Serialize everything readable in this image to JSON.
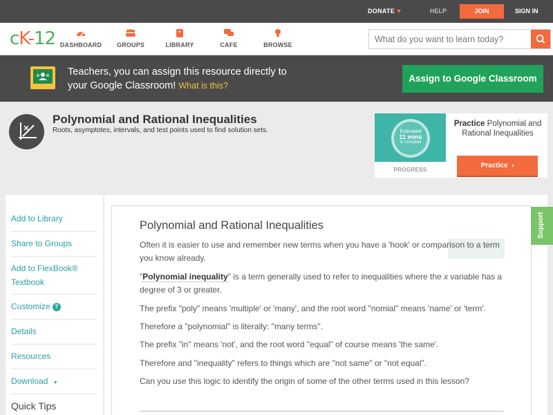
{
  "topbar": {
    "donate": "DONATE",
    "help": "HELP",
    "join": "JOIN",
    "signin": "SIGN IN"
  },
  "nav": {
    "logo_c": "c",
    "logo_k": "K",
    "logo_dash": "-",
    "logo_12": "12",
    "items": [
      {
        "label": "DASHBOARD",
        "icon": "dashboard-gauge-icon"
      },
      {
        "label": "GROUPS",
        "icon": "groups-people-icon"
      },
      {
        "label": "LIBRARY",
        "icon": "library-book-icon"
      },
      {
        "label": "CAFE",
        "icon": "cafe-chat-icon"
      },
      {
        "label": "BROWSE",
        "icon": "browse-lightbulb-icon"
      }
    ],
    "search_placeholder": "What do you want to learn today?"
  },
  "banner": {
    "text_line1": "Teachers, you can assign this resource directly to",
    "text_line2": "your Google Classroom!",
    "what_link": "What is this?",
    "button": "Assign to Google Classroom"
  },
  "lesson": {
    "title": "Polynomial and Rational Inequalities",
    "subtitle": "Roots, asymptotes, intervals, and test points used to find solution sets."
  },
  "practice_card": {
    "estimated": "Estimated",
    "mins": "11 mins",
    "to_complete": "to complete",
    "progress": "PROGRESS",
    "title_bold": "Practice",
    "title_rest": "Polynomial and Rational Inequalities",
    "button": "Practice"
  },
  "sidebar": {
    "items": [
      "Add to Library",
      "Share to Groups",
      "Add to FlexBook®",
      "Textbook",
      "Customize",
      "Details",
      "Resources",
      "Download"
    ],
    "help_badge": "?",
    "download_caret": "▼",
    "quick_tips": "Quick Tips"
  },
  "content": {
    "title": "Polynomial and Rational Inequalities",
    "p1": "Often it is easier to use and remember new terms when you have a 'hook' or comparison to a term you know already.",
    "p2_open_quote": "\"",
    "p2_term": "Polynomial inequality",
    "p2_close_quote": "\"",
    "p2_a": " is a term generally used to refer to inequalities where the ",
    "p2_x": "x",
    "p2_b": " variable has a degree of 3 or greater.",
    "p3": "The prefix \"poly\" means 'multiple' or 'many', and the root word \"nomial\" means 'name' or 'term'.",
    "p4": "Therefore a \"polynomial\" is literally: \"many terms\".",
    "p5": "The prefix \"in\" means 'not', and the root word \"equal\" of course means 'the same'.",
    "p6": "Therefore and \"inequality\" refers to things which are \"not same\" or \"not equal\".",
    "p7": "Can you use this logic to identify the origin of some of the other terms used in this lesson?"
  },
  "support": "Support",
  "colors": {
    "accent_orange": "#f26a3d",
    "brand_green": "#4bb05b",
    "classroom_green": "#21a25a",
    "link_teal": "#2a9ea7",
    "dark_bar": "#4a4a4a"
  }
}
